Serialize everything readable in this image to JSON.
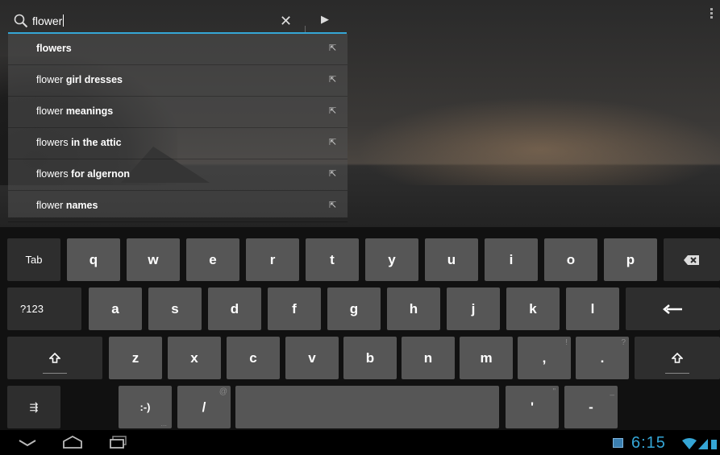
{
  "search": {
    "query": "flower",
    "icons": {
      "search": "magnifier-icon",
      "clear": "close-icon",
      "go": "arrow-right-icon"
    }
  },
  "suggestions": [
    {
      "prefix": "flowers",
      "suffix": ""
    },
    {
      "prefix": "flower",
      "suffix": " girl dresses"
    },
    {
      "prefix": "flower",
      "suffix": " meanings"
    },
    {
      "prefix": "flowers",
      "suffix": " in the attic"
    },
    {
      "prefix": "flowers",
      "suffix": " for algernon"
    },
    {
      "prefix": "flower",
      "suffix": " names"
    }
  ],
  "keyboard": {
    "row1": [
      "Tab",
      "q",
      "w",
      "e",
      "r",
      "t",
      "y",
      "u",
      "i",
      "o",
      "p"
    ],
    "row2": [
      "?123",
      "a",
      "s",
      "d",
      "f",
      "g",
      "h",
      "j",
      "k",
      "l"
    ],
    "row3": [
      "z",
      "x",
      "c",
      "v",
      "b",
      "n",
      "m",
      ",",
      "."
    ],
    "row3_hints": {
      "comma": "!",
      "period": "?"
    },
    "row4": {
      "settings": "⇶",
      "smiley": ":-)",
      "smiley_sub": "...",
      "slash": "/",
      "slash_hint": "@",
      "apostrophe": "'",
      "apostrophe_hint": "\"",
      "dash": "-",
      "dash_hint": "_"
    },
    "icons": {
      "backspace": "backspace-icon",
      "enter": "enter-arrow-icon",
      "shift": "shift-icon"
    }
  },
  "status": {
    "time": "6:15"
  },
  "colors": {
    "accent": "#35a6d6",
    "key": "#565656",
    "key_dark": "#2e2e2e"
  }
}
